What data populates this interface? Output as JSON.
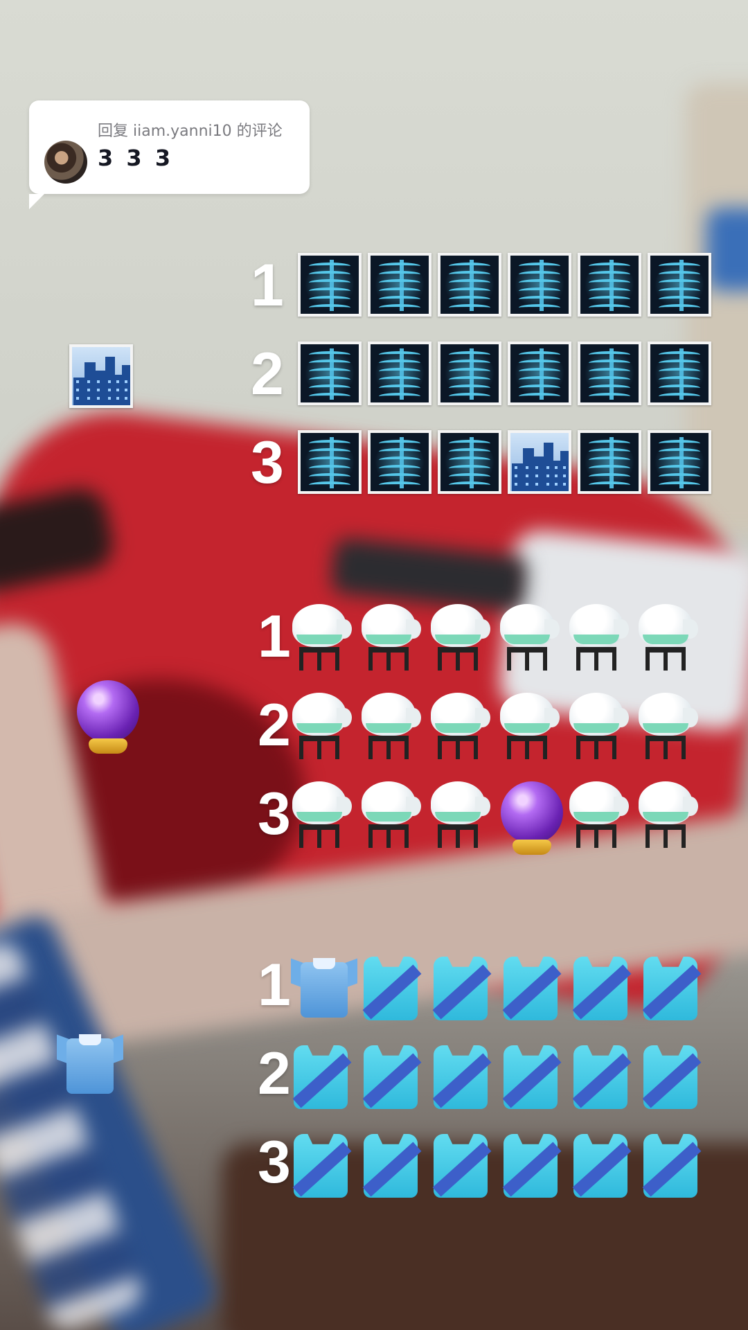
{
  "comment_reply": {
    "label": "回复 iiam.yanni10 的评论",
    "text": "3 3 3"
  },
  "puzzles": [
    {
      "name": "xray",
      "repeated_icon": "x-ray-icon",
      "odd_icon": "night-city-icon",
      "row_labels": [
        "1",
        "2",
        "3"
      ],
      "odd_row": 2,
      "odd_col": 3
    },
    {
      "name": "jar",
      "repeated_icon": "bubble-jar-icon",
      "odd_icon": "crystal-ball-icon",
      "row_labels": [
        "1",
        "2",
        "3"
      ],
      "odd_row": 2,
      "odd_col": 3
    },
    {
      "name": "shirt",
      "repeated_icon": "running-shirt-icon",
      "odd_icon": "polo-shirt-icon",
      "row_labels": [
        "1",
        "2",
        "3"
      ],
      "odd_row": 0,
      "odd_col": 0
    }
  ],
  "colors": {
    "bubble_bg": "#ffffff",
    "reply_label": "#7a7a7f",
    "reply_text": "#161823",
    "row_number": "#ffffff"
  }
}
